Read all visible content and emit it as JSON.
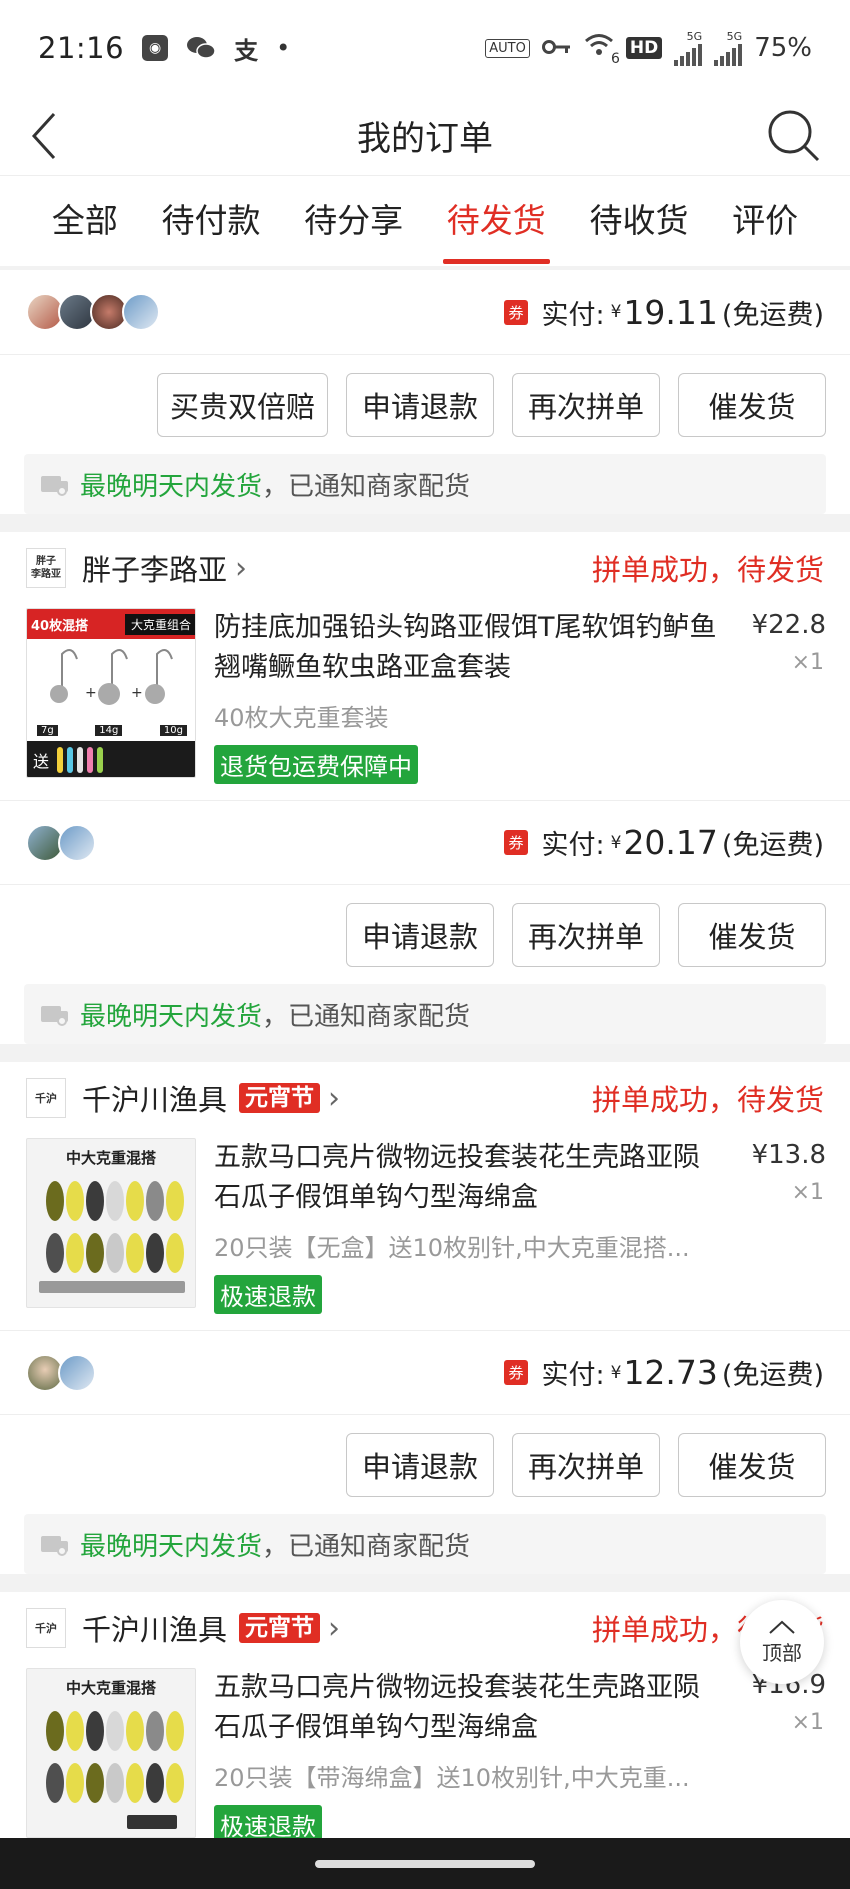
{
  "status_bar": {
    "time": "21:16",
    "wifi_label": "6",
    "hd_label": "HD",
    "net1": "5G",
    "net2": "5G",
    "battery": "75%"
  },
  "nav": {
    "title": "我的订单"
  },
  "tabs": [
    {
      "label": "全部",
      "active": false
    },
    {
      "label": "待付款",
      "active": false
    },
    {
      "label": "待分享",
      "active": false
    },
    {
      "label": "待发货",
      "active": true
    },
    {
      "label": "待收货",
      "active": false
    },
    {
      "label": "评价",
      "active": false
    }
  ],
  "orders": [
    {
      "pay_label": "实付:",
      "currency": "¥",
      "pay_amount": "19.11",
      "shipping": "(免运费)",
      "coupon": "券",
      "buttons": [
        "买贵双倍赔",
        "申请退款",
        "再次拼单",
        "催发货"
      ],
      "notice_green": "最晚明天内发货",
      "notice_rest": "，已通知商家配货"
    },
    {
      "shop_logo_text": "胖子李路亚",
      "shop_name": "胖子李路亚",
      "status": "拼单成功，待发货",
      "goods": {
        "title": "防挂底加强铅头钩路亚假饵T尾软饵钓鲈鱼翘嘴鳜鱼软虫路亚盒套装",
        "spec": "40枚大克重套装",
        "tag": "退货包运费保障中",
        "price": "¥22.8",
        "qty": "×1",
        "thumb_badge": "40枚混搭",
        "thumb_badge2": "大克重组合",
        "thumb_labels": [
          "7g",
          "14g",
          "10g"
        ],
        "thumb_send": "送"
      },
      "pay_label": "实付:",
      "currency": "¥",
      "pay_amount": "20.17",
      "shipping": "(免运费)",
      "coupon": "券",
      "buttons": [
        "申请退款",
        "再次拼单",
        "催发货"
      ],
      "notice_green": "最晚明天内发货",
      "notice_rest": "，已通知商家配货"
    },
    {
      "shop_logo_text": "千沪",
      "shop_name": "千沪川渔具",
      "promo": "元宵节",
      "status": "拼单成功，待发货",
      "goods": {
        "title": "五款马口亮片微物远投套装花生壳路亚陨石瓜子假饵单钩勺型海绵盒",
        "spec": "20只装【无盒】送10枚别针,中大克重混搭...",
        "tag": "极速退款",
        "price": "¥13.8",
        "qty": "×1",
        "thumb_title": "中大克重混搭"
      },
      "pay_label": "实付:",
      "currency": "¥",
      "pay_amount": "12.73",
      "shipping": "(免运费)",
      "coupon": "券",
      "buttons": [
        "申请退款",
        "再次拼单",
        "催发货"
      ],
      "notice_green": "最晚明天内发货",
      "notice_rest": "，已通知商家配货"
    },
    {
      "shop_logo_text": "千沪",
      "shop_name": "千沪川渔具",
      "promo": "元宵节",
      "status": "拼单成功，待发货",
      "goods": {
        "title": "五款马口亮片微物远投套装花生壳路亚陨石瓜子假饵单钩勺型海绵盒",
        "spec": "20只装【带海绵盒】送10枚别针,中大克重...",
        "tag": "极速退款",
        "price": "¥16.9",
        "qty": "×1",
        "thumb_title": "中大克重混搭"
      }
    }
  ],
  "back_to_top": "顶部",
  "colors": {
    "accent": "#e02e24",
    "green": "#23a53c"
  }
}
